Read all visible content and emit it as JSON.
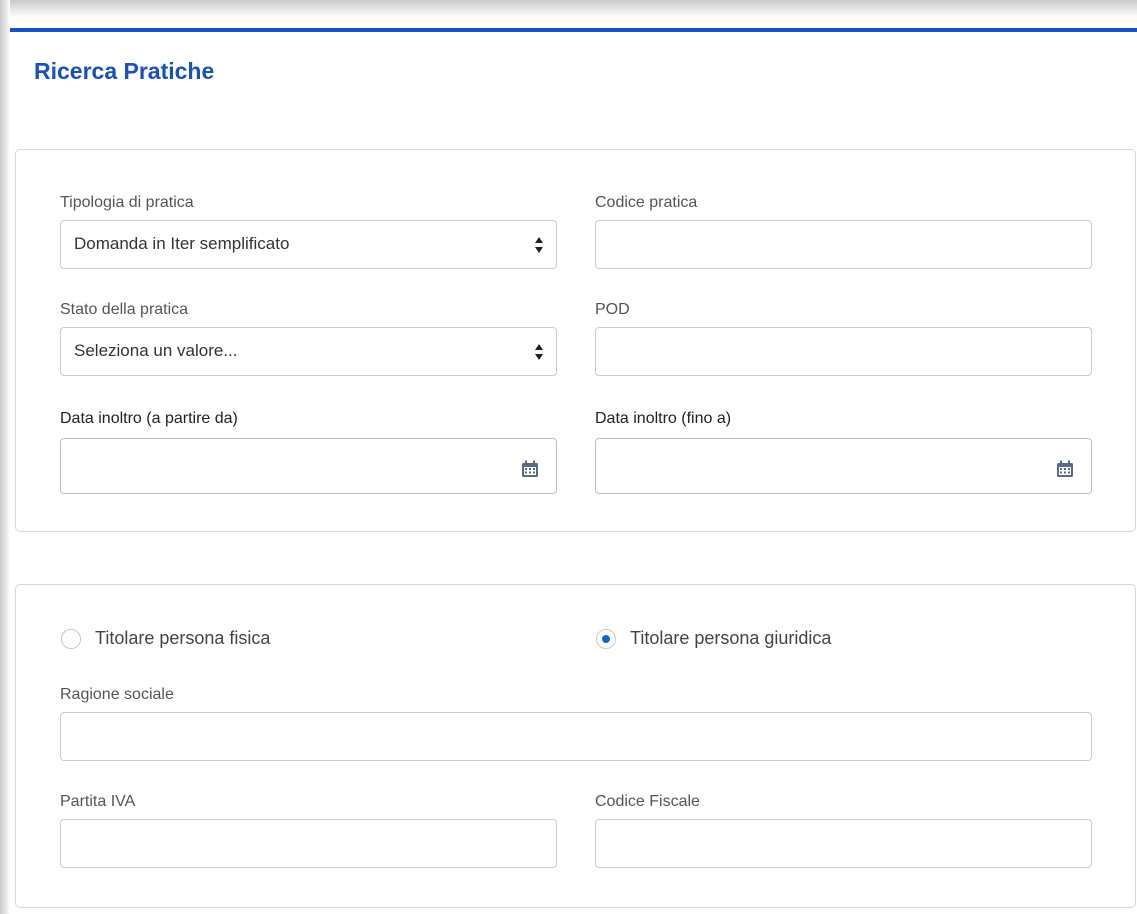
{
  "colors": {
    "accent": "#1750c1",
    "radio_selected": "#0a66d6"
  },
  "page": {
    "title": "Ricerca Pratiche"
  },
  "search_form": {
    "tipologia": {
      "label": "Tipologia di pratica",
      "value": "Domanda in Iter semplificato",
      "icon": "select-arrows-icon"
    },
    "codice_pratica": {
      "label": "Codice pratica",
      "value": ""
    },
    "stato": {
      "label": "Stato della pratica",
      "value": "Seleziona un valore...",
      "icon": "select-arrows-icon"
    },
    "pod": {
      "label": "POD",
      "value": ""
    },
    "data_da": {
      "label": "Data inoltro (a partire da)",
      "value": "",
      "icon": "calendar-icon"
    },
    "data_a": {
      "label": "Data inoltro (fino a)",
      "value": "",
      "icon": "calendar-icon"
    }
  },
  "owner_form": {
    "radio_fisica": {
      "label": "Titolare persona fisica",
      "selected": false
    },
    "radio_giuridica": {
      "label": "Titolare persona giuridica",
      "selected": true
    },
    "ragione_sociale": {
      "label": "Ragione sociale",
      "value": ""
    },
    "partita_iva": {
      "label": "Partita IVA",
      "value": ""
    },
    "codice_fiscale": {
      "label": "Codice Fiscale",
      "value": ""
    }
  }
}
